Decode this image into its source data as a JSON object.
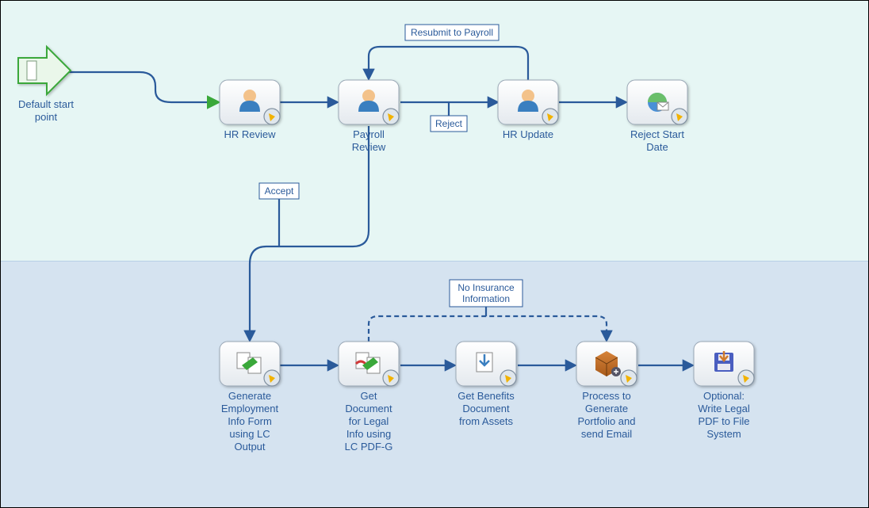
{
  "diagram": {
    "start_label": "Default start point",
    "nodes": {
      "hr_review": {
        "label_lines": [
          "HR Review"
        ]
      },
      "payroll": {
        "label_lines": [
          "Payroll",
          "Review"
        ]
      },
      "hr_update": {
        "label_lines": [
          "HR Update"
        ]
      },
      "reject_date": {
        "label_lines": [
          "Reject Start",
          "Date"
        ]
      },
      "gen_form": {
        "label_lines": [
          "Generate",
          "Employment",
          "Info Form",
          "using LC",
          "Output"
        ]
      },
      "get_legal": {
        "label_lines": [
          "Get",
          "Document",
          "for Legal",
          "Info using",
          "LC PDF-G"
        ]
      },
      "get_benefits": {
        "label_lines": [
          "Get Benefits",
          "Document",
          "from Assets"
        ]
      },
      "process": {
        "label_lines": [
          "Process to",
          "Generate",
          "Portfolio and",
          "send Email"
        ]
      },
      "optional": {
        "label_lines": [
          "Optional:",
          "Write Legal",
          "PDF to File",
          "System"
        ]
      }
    },
    "labels": {
      "resubmit": "Resubmit to Payroll",
      "reject": "Reject",
      "accept": "Accept",
      "no_insurance_lines": [
        "No Insurance",
        "Information"
      ]
    }
  }
}
